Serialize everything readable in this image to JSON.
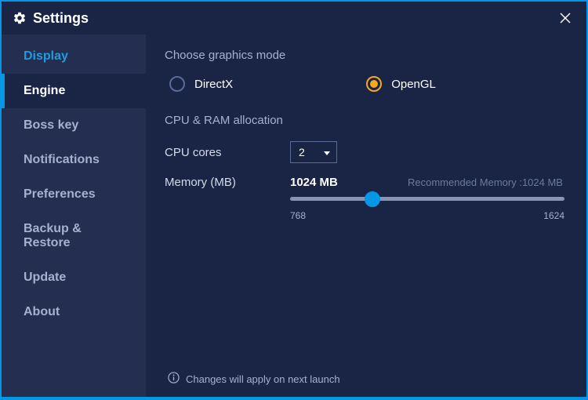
{
  "window": {
    "title": "Settings"
  },
  "sidebar": {
    "items": [
      {
        "label": "Display"
      },
      {
        "label": "Engine"
      },
      {
        "label": "Boss key"
      },
      {
        "label": "Notifications"
      },
      {
        "label": "Preferences"
      },
      {
        "label": "Backup & Restore"
      },
      {
        "label": "Update"
      },
      {
        "label": "About"
      }
    ]
  },
  "main": {
    "graphics_title": "Choose graphics mode",
    "graphics_options": {
      "directx": "DirectX",
      "opengl": "OpenGL"
    },
    "alloc_title": "CPU & RAM allocation",
    "cpu_label": "CPU cores",
    "cpu_value": "2",
    "mem_label": "Memory (MB)",
    "mem_value": "1024 MB",
    "mem_recommended": "Recommended Memory :1024 MB",
    "slider": {
      "min": "768",
      "max": "1624"
    },
    "footer": "Changes will apply on next launch"
  }
}
